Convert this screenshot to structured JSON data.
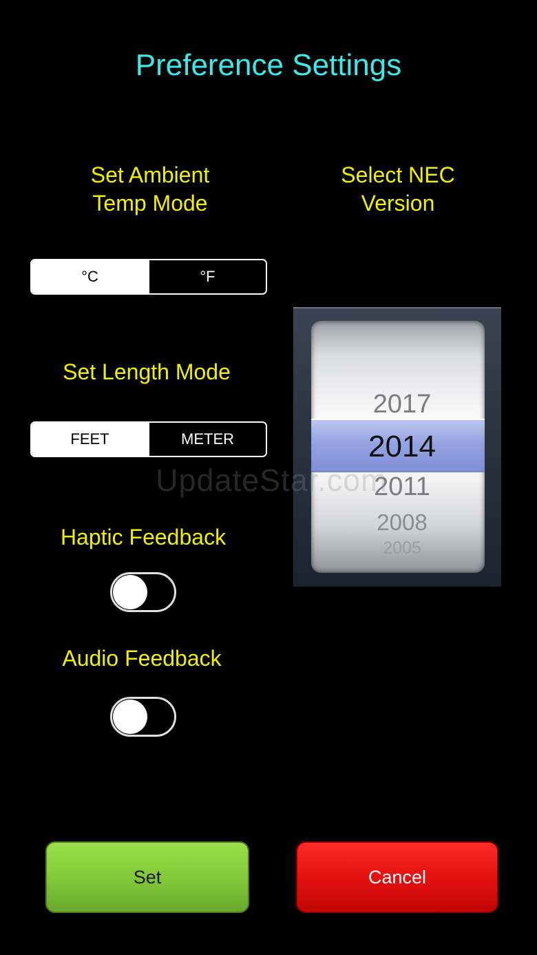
{
  "page": {
    "title": "Preference Settings"
  },
  "ambient_temp": {
    "label": "Set Ambient\nTemp Mode",
    "options": [
      "°C",
      "°F"
    ],
    "selected": "°C"
  },
  "nec": {
    "label": "Select NEC\nVersion",
    "options": [
      "2017",
      "2014",
      "2011",
      "2008",
      "2005"
    ],
    "selected": "2014"
  },
  "length": {
    "label": "Set Length Mode",
    "options": [
      "FEET",
      "METER"
    ],
    "selected": "FEET"
  },
  "haptic": {
    "label": "Haptic Feedback",
    "enabled": false
  },
  "audio": {
    "label": "Audio Feedback",
    "enabled": false
  },
  "buttons": {
    "set": "Set",
    "cancel": "Cancel"
  },
  "watermark": "UpdateStar.com",
  "colors": {
    "title": "#3de8e8",
    "label": "#f2f200",
    "set_button": "#82c93a",
    "cancel_button": "#e51010",
    "picker_selection": "#8d9ce0"
  }
}
